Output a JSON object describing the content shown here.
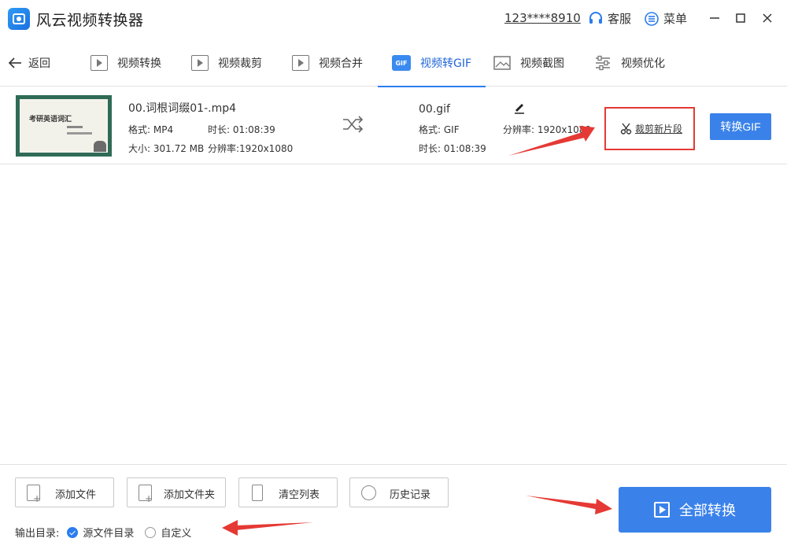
{
  "app": {
    "title": "风云视频转换器",
    "phone": "123****8910",
    "service_label": "客服",
    "menu_label": "菜单"
  },
  "nav": {
    "back_label": "返回",
    "tabs": [
      {
        "label": "视频转换",
        "icon": "video-play-icon"
      },
      {
        "label": "视频裁剪",
        "icon": "video-crop-icon"
      },
      {
        "label": "视频合并",
        "icon": "video-merge-icon"
      },
      {
        "label": "视频转GIF",
        "icon": "gif-icon",
        "active": true
      },
      {
        "label": "视频截图",
        "icon": "image-icon"
      },
      {
        "label": "视频优化",
        "icon": "sliders-icon"
      }
    ],
    "gif_icon_text": "GIF"
  },
  "file": {
    "thumb_text": "考研英语词汇",
    "source": {
      "name": "00.词根词缀01-.mp4",
      "format": "格式: MP4",
      "duration": "时长: 01:08:39",
      "size": "大小: 301.72 MB",
      "resolution": "分辨率:1920x1080"
    },
    "output": {
      "name": "00.gif",
      "format": "格式: GIF",
      "duration": "时长: 01:08:39",
      "resolution": "分辨率: 1920x1080"
    },
    "trim_label": "裁剪新片段",
    "convert_label": "转换GIF"
  },
  "bottom": {
    "add_file": "添加文件",
    "add_folder": "添加文件夹",
    "clear_list": "清空列表",
    "history": "历史记录",
    "output_dir_label": "输出目录:",
    "option_source": "源文件目录",
    "option_custom": "自定义",
    "selected_option": "源文件目录",
    "convert_all": "全部转换"
  },
  "colors": {
    "accent": "#3a82ea",
    "annotation": "#e53935"
  }
}
